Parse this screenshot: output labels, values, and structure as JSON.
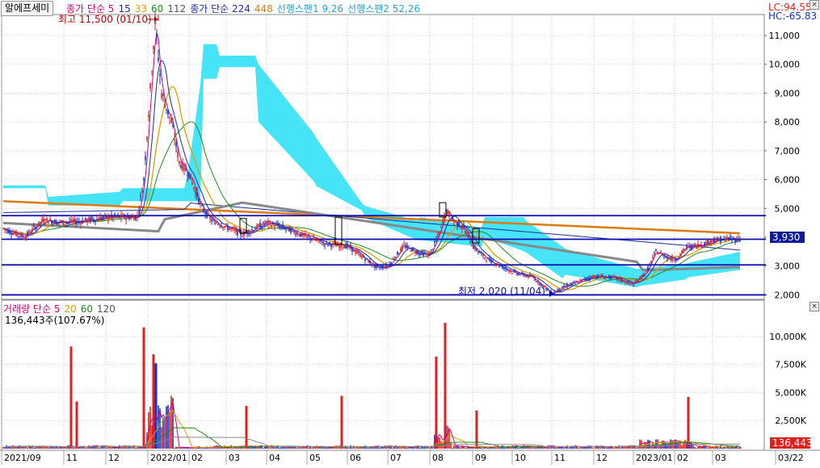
{
  "toolbar": {
    "stock_name": "알에프세미"
  },
  "price_legend": [
    {
      "text": "종가 단순 5",
      "color": "#d0007a"
    },
    {
      "text": "15",
      "color": "#1a2ea0"
    },
    {
      "text": "33",
      "color": "#d8a000"
    },
    {
      "text": "60",
      "color": "#1e8a1e"
    },
    {
      "text": "112",
      "color": "#555555"
    },
    {
      "text": "종가 단순 224",
      "color": "#1a2ea0"
    },
    {
      "text": "448",
      "color": "#e07a10"
    },
    {
      "text": "선행스팬1 9,26",
      "color": "#22a0e0"
    },
    {
      "text": "선행스팬2 52,26",
      "color": "#22a0e0"
    }
  ],
  "volume_legend": [
    {
      "text": "거래량 단순 5",
      "color": "#d0007a"
    },
    {
      "text": "20",
      "color": "#d8a000"
    },
    {
      "text": "60",
      "color": "#1e8a1e"
    },
    {
      "text": "120",
      "color": "#555555"
    }
  ],
  "volume_info": "136,443주(107.67%)",
  "lc": "LC:94.55",
  "hc": "HC:-65.83",
  "current_price_label": "3,930",
  "current_volume_label": "136,443",
  "colors": {
    "up": "#e0201e",
    "down": "#1432c8",
    "cloud": "#33e0f5",
    "hline": "#0a0ab4"
  },
  "chart_data": [
    {
      "type": "candlestick",
      "title": "",
      "ylim": [
        1900,
        11700
      ],
      "y_ticks": [
        2000,
        3000,
        4000,
        5000,
        6000,
        7000,
        8000,
        9000,
        10000,
        11000
      ],
      "y_tick_labels": [
        "2,000",
        "3,000",
        "4,000",
        "5,000",
        "6,000",
        "7,000",
        "8,000",
        "9,000",
        "10,000",
        "11,000"
      ],
      "x_ticks": [
        "2021/09",
        "11",
        "12",
        "2022/01",
        "02",
        "03",
        "04",
        "05",
        "06",
        "07",
        "08",
        "09",
        "10",
        "11",
        "12",
        "2023/01",
        "02",
        "03",
        "03/22"
      ],
      "horizontal_lines": [
        4750,
        3930,
        3040,
        2000
      ],
      "current_price": 3930,
      "annotations": [
        {
          "text": "최고 11,500 (01/10)",
          "value": 11500,
          "date": "2022/01/10"
        },
        {
          "text": "최저 2,020 (11/04)",
          "value": 2020,
          "date": "2022/11/04"
        }
      ],
      "price_path": [
        [
          "2021/09",
          4300
        ],
        [
          "2021/09 mid",
          4000
        ],
        [
          "2021/10",
          4600
        ],
        [
          "2021/11",
          4500
        ],
        [
          "2021/12",
          4700
        ],
        [
          "2021/12 late",
          6000
        ],
        [
          "2022/01",
          11500
        ],
        [
          "2022/01 late",
          8500
        ],
        [
          "2022/02",
          6500
        ],
        [
          "2022/03",
          5200
        ],
        [
          "2022/03 mid",
          4400
        ],
        [
          "2022/04",
          4500
        ],
        [
          "2022/05",
          4000
        ],
        [
          "2022/06",
          3600
        ],
        [
          "2022/07",
          2900
        ],
        [
          "2022/07 mid",
          3700
        ],
        [
          "2022/08",
          3500
        ],
        [
          "2022/08 mid",
          5100
        ],
        [
          "2022/09",
          4200
        ],
        [
          "2022/09 mid",
          3400
        ],
        [
          "2022/10",
          2700
        ],
        [
          "2022/11",
          2020
        ],
        [
          "2022/12",
          2600
        ],
        [
          "2023/01",
          2400
        ],
        [
          "2023/01 mid",
          3400
        ],
        [
          "2023/02",
          3800
        ],
        [
          "2023/03",
          3950
        ],
        [
          "2023/03/22",
          3930
        ]
      ]
    },
    {
      "type": "bar",
      "title": "",
      "ylim": [
        0,
        12000000
      ],
      "y_ticks": [
        2500000,
        5000000,
        7500000,
        10000000
      ],
      "y_tick_labels": [
        "2,500K",
        "5,000K",
        "7,500K",
        "10,000K"
      ],
      "spikes": [
        {
          "date": "2021/10",
          "value": 9100000,
          "color": "up"
        },
        {
          "date": "2021/11",
          "value": 4200000,
          "color": "up"
        },
        {
          "date": "2021/12 late",
          "value": 10800000,
          "color": "up"
        },
        {
          "date": "2022/01",
          "value": 8400000,
          "color": "up"
        },
        {
          "date": "2022/01 early",
          "value": 7600000,
          "color": "down"
        },
        {
          "date": "2022/03",
          "value": 3800000,
          "color": "up"
        },
        {
          "date": "2022/06",
          "value": 4700000,
          "color": "up"
        },
        {
          "date": "2022/08",
          "value": 8200000,
          "color": "up"
        },
        {
          "date": "2022/08 mid",
          "value": 11200000,
          "color": "up"
        },
        {
          "date": "2022/09",
          "value": 3400000,
          "color": "up"
        },
        {
          "date": "2023/02",
          "value": 4600000,
          "color": "up"
        },
        {
          "date": "2023/03/22",
          "value": 136443,
          "color": "up"
        }
      ],
      "current_volume": 136443
    }
  ]
}
